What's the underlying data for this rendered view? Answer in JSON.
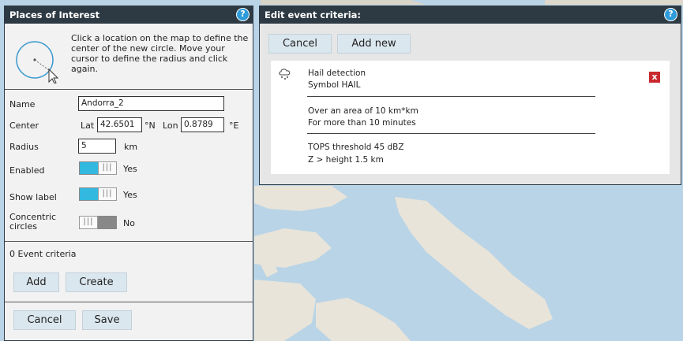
{
  "poi_panel": {
    "title": "Places of Interest",
    "instructions": "Click a location on the map to define the center of the new circle. Move your cursor to define the radius and click again.",
    "name_label": "Name",
    "name_value": "Andorra_2",
    "center_label": "Center",
    "lat_label": "Lat",
    "lat_value": "42.6501",
    "lat_unit": "°N",
    "lon_label": "Lon",
    "lon_value": "0.8789",
    "lon_unit": "°E",
    "radius_label": "Radius",
    "radius_value": "5",
    "radius_unit": "km",
    "enabled_label": "Enabled",
    "enabled_value": "Yes",
    "show_label_label": "Show label",
    "show_label_value": "Yes",
    "concentric_label": "Concentric circles",
    "concentric_value": "No",
    "event_criteria_count": "0 Event criteria",
    "add_label": "Add",
    "create_label": "Create",
    "cancel_label": "Cancel",
    "save_label": "Save"
  },
  "event_panel": {
    "title": "Edit event criteria:",
    "cancel_label": "Cancel",
    "add_new_label": "Add new",
    "criterion": {
      "name": "Hail detection",
      "symbol": "Symbol HAIL",
      "area": "Over an area of 10 km*km",
      "duration": "For more than 10 minutes",
      "threshold": "TOPS threshold 45 dBZ",
      "height": "Z > height 1.5 km",
      "delete_label": "x"
    }
  },
  "colors": {
    "header_bg": "#2d3a44",
    "help_blue": "#2f9bd9",
    "toggle_on": "#33b9e0",
    "delete_red": "#c8282e",
    "map_water": "#b6d2e4"
  }
}
